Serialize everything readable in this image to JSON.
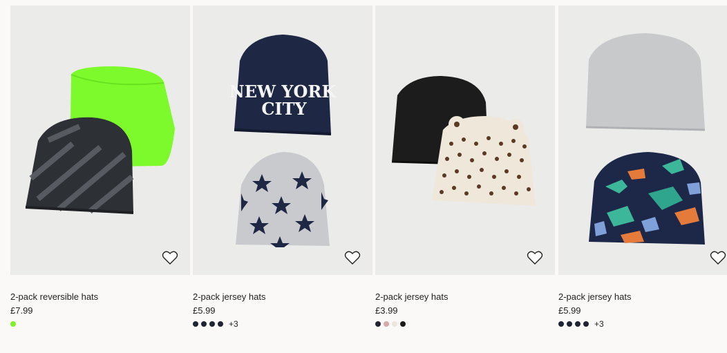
{
  "products": [
    {
      "title": "2-pack reversible hats",
      "price": "£7.99",
      "swatches": [
        "#7ef02a"
      ],
      "more": ""
    },
    {
      "title": "2-pack jersey hats",
      "price": "£5.99",
      "swatches": [
        "#1f2433",
        "#1f2433",
        "#1f2433",
        "#1f2433"
      ],
      "more": "+3",
      "print_text_line1": "NEW YORK",
      "print_text_line2": "CITY"
    },
    {
      "title": "2-pack jersey hats",
      "price": "£3.99",
      "swatches": [
        "#1f2433",
        "#d9a8a8",
        "#ece6dc",
        "#1a1a1a"
      ],
      "more": ""
    },
    {
      "title": "2-pack jersey hats",
      "price": "£5.99",
      "swatches": [
        "#1f2433",
        "#1f2433",
        "#1f2433",
        "#1f2433"
      ],
      "more": "+3"
    }
  ],
  "icons": {
    "favourite": "heart-outline-icon"
  }
}
